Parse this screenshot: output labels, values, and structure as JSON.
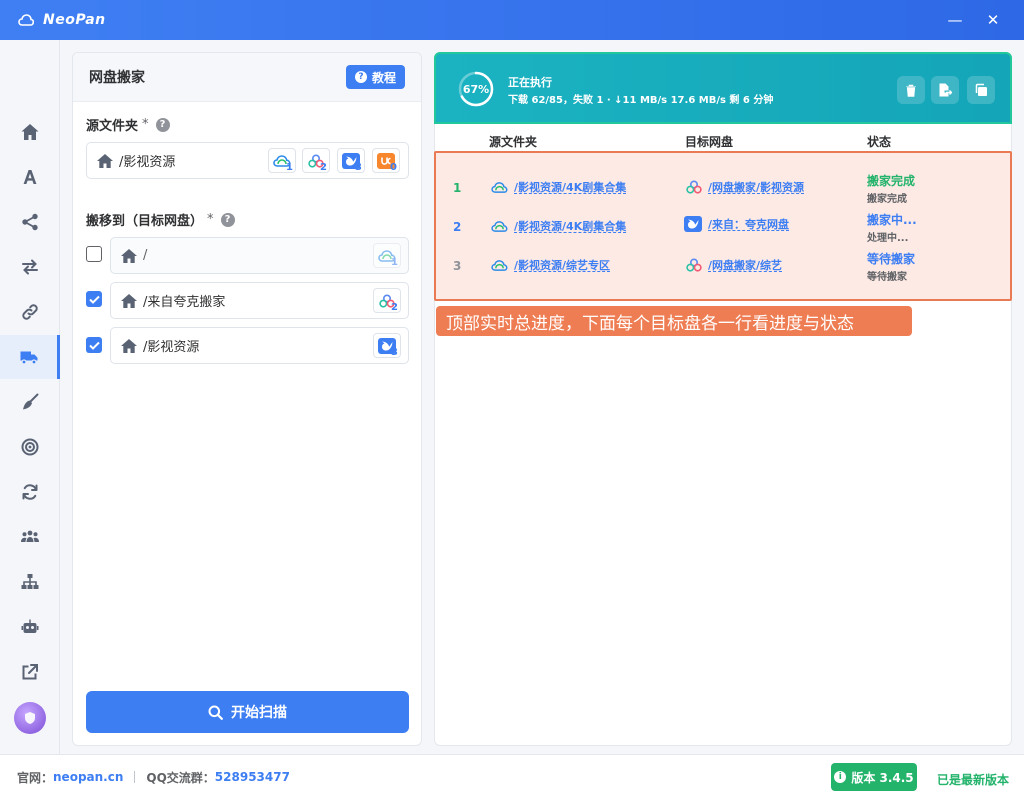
{
  "app": {
    "title": "NeoPan"
  },
  "window_controls": {
    "minimize": "—",
    "close": "✕"
  },
  "sidebar": {
    "items": [
      {
        "name": "home-icon",
        "active": false
      },
      {
        "name": "font-icon",
        "active": false
      },
      {
        "name": "share-icon",
        "active": false
      },
      {
        "name": "transfer-icon",
        "active": false
      },
      {
        "name": "link-icon",
        "active": false
      },
      {
        "name": "truck-icon",
        "active": true
      },
      {
        "name": "broom-icon",
        "active": false
      },
      {
        "name": "target-icon",
        "active": false
      },
      {
        "name": "sync-icon",
        "active": false
      },
      {
        "name": "users-icon",
        "active": false
      },
      {
        "name": "sitemap-icon",
        "active": false
      },
      {
        "name": "robot-icon",
        "active": false
      },
      {
        "name": "external-link-icon",
        "active": false
      }
    ]
  },
  "left_panel": {
    "title": "网盘搬家",
    "tutorial_label": "教程",
    "source": {
      "label": "源文件夹",
      "required_mark": "*",
      "path": "/影视资源",
      "tags": [
        {
          "icon": "baidu-cloud-icon",
          "count": "1"
        },
        {
          "icon": "aliyun-drive-icon",
          "count": "2"
        },
        {
          "icon": "quark-icon",
          "count": "3"
        },
        {
          "icon": "uc-drive-icon",
          "count": "0"
        }
      ]
    },
    "target": {
      "label": "搬移到（目标网盘）",
      "required_mark": "*",
      "rows": [
        {
          "checked": false,
          "path": "/",
          "icon": "baidu-cloud-icon",
          "count": "1"
        },
        {
          "checked": true,
          "path": "/来自夸克搬家",
          "icon": "aliyun-drive-icon",
          "count": "2"
        },
        {
          "checked": true,
          "path": "/影视资源",
          "icon": "quark-icon",
          "count": "3"
        }
      ]
    },
    "scan_button": "开始扫描"
  },
  "progress": {
    "percent": "67%",
    "fraction": 0.67,
    "status": "正在执行",
    "detail": "下载 62/85，失败 1 · ↓11 MB/s 17.6 MB/s 剩 6 分钟"
  },
  "table": {
    "headers": {
      "source": "源文件夹",
      "target": "目标网盘",
      "status": "状态"
    },
    "rows": [
      {
        "idx": "1",
        "source": "/影视资源/4K剧集合集",
        "target": "/网盘搬家/影视资源",
        "target_icon": "aliyun-drive-icon",
        "status": "搬家完成",
        "substatus": "搬家完成",
        "status_color": "#24b36b",
        "idx_color": "#24b36b"
      },
      {
        "idx": "2",
        "source": "/影视资源/4K剧集合集",
        "target": "/来自：夸克网盘",
        "target_icon": "quark-icon",
        "status": "搬家中...",
        "substatus": "处理中...",
        "status_color": "#3d7ef2",
        "idx_color": "#3d7ef2"
      },
      {
        "idx": "3",
        "source": "/影视资源/综艺专区",
        "target": "/网盘搬家/综艺",
        "target_icon": "aliyun-drive-icon",
        "status": "等待搬家",
        "substatus": "等待搬家",
        "status_color": "#3d7ef2",
        "idx_color": "#909399"
      }
    ]
  },
  "annotation": "顶部实时总进度，下面每个目标盘各一行看进度与状态",
  "footer": {
    "site_label": "官网：",
    "site": "neopan.cn",
    "qq_label": "QQ交流群：",
    "qq": "528953477",
    "version": "版本 3.4.5",
    "latest": "已是最新版本"
  },
  "colors": {
    "accent": "#3d7ef2",
    "success": "#24b36b",
    "highlight": "#ea7a53",
    "progress": "#14a5b8"
  }
}
